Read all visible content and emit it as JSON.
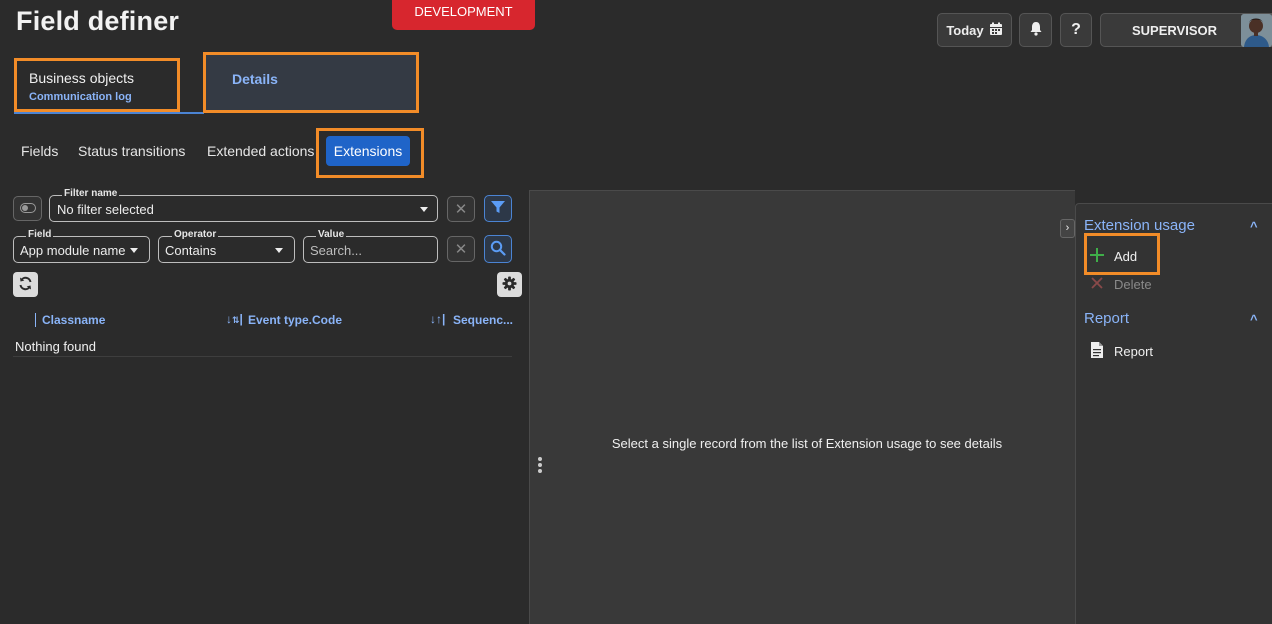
{
  "header": {
    "title": "Field definer",
    "environment": "DEVELOPMENT",
    "today_label": "Today",
    "help_label": "?",
    "user_label": "SUPERVISOR",
    "icons": {
      "calendar": "calendar-icon",
      "bell": "bell-icon",
      "avatar": "avatar"
    }
  },
  "top_tabs": [
    {
      "label": "Business objects",
      "sublabel": "Communication log",
      "active": true
    },
    {
      "label": "Details",
      "active": false
    }
  ],
  "sub_tabs": [
    {
      "label": "Fields"
    },
    {
      "label": "Status transitions"
    },
    {
      "label": "Extended actions"
    },
    {
      "label": "Extensions",
      "active": true
    }
  ],
  "filter": {
    "filter_name_legend": "Filter name",
    "filter_name_value": "No filter selected",
    "field_legend": "Field",
    "field_value": "App module name",
    "operator_legend": "Operator",
    "operator_value": "Contains",
    "value_legend": "Value",
    "value_placeholder": "Search..."
  },
  "grid": {
    "columns": [
      {
        "label": "Classname"
      },
      {
        "label": "Event type.Code",
        "sort": "desc-numeric"
      },
      {
        "label": "Sequenc...",
        "sort": "asc"
      }
    ],
    "empty_text": "Nothing found"
  },
  "detail": {
    "placeholder": "Select a single record from the list of Extension usage to see details"
  },
  "actions": {
    "sections": [
      {
        "title": "Extension usage",
        "items": [
          {
            "label": "Add",
            "enabled": true
          },
          {
            "label": "Delete",
            "enabled": false
          }
        ]
      },
      {
        "title": "Report",
        "items": [
          {
            "label": "Report",
            "enabled": true
          }
        ]
      }
    ]
  },
  "colors": {
    "background": "#2b2b2b",
    "accent": "#8ab4f8",
    "active_tab": "#1f64c8",
    "env_badge": "#d7262e",
    "highlight": "#f28c28",
    "add_icon": "#3fae49"
  }
}
